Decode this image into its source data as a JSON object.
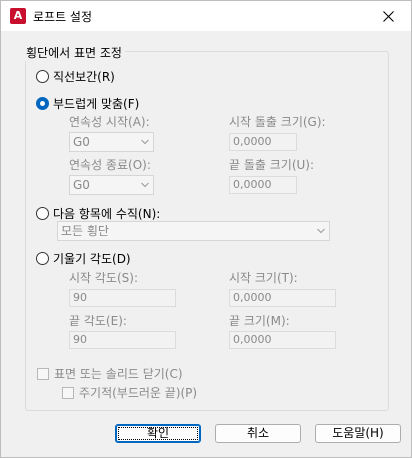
{
  "window": {
    "title": "로프트 설정",
    "app_icon_letter": "A"
  },
  "group": {
    "legend": "횡단에서 표면 조정"
  },
  "radios": {
    "straight": "직선보간(R)",
    "smooth": "부드럽게 맞춤(F)",
    "normal_to": "다음 항목에 수직(N):",
    "draft": "기울기 각도(D)"
  },
  "smooth_fit": {
    "start_continuity_label": "연속성 시작(A):",
    "start_continuity_value": "G0",
    "start_bulge_label": "시작 돌출 크기(G):",
    "start_bulge_value": "0,0000",
    "end_continuity_label": "연속성 종료(O):",
    "end_continuity_value": "G0",
    "end_bulge_label": "끝 돌출 크기(U):",
    "end_bulge_value": "0,0000"
  },
  "normal_to": {
    "value": "모든 횡단"
  },
  "draft_angles": {
    "start_angle_label": "시작 각도(S):",
    "start_angle_value": "90",
    "start_magnitude_label": "시작 크기(T):",
    "start_magnitude_value": "0,0000",
    "end_angle_label": "끝 각도(E):",
    "end_angle_value": "90",
    "end_magnitude_label": "끝 크기(M):",
    "end_magnitude_value": "0,0000"
  },
  "checkboxes": {
    "close_surface": "표면 또는 솔리드 닫기(C)",
    "periodic": "주기적(부드러운 끝)(P)"
  },
  "buttons": {
    "ok": "확인",
    "cancel": "취소",
    "help": "도움말(H)"
  },
  "state": {
    "selected_radio": "smooth"
  }
}
